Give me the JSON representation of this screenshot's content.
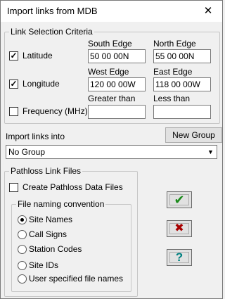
{
  "window": {
    "title": "Import links from MDB",
    "close_glyph": "✕"
  },
  "criteria": {
    "group_label": "Link Selection Criteria",
    "latitude": {
      "label": "Latitude",
      "checked": true
    },
    "longitude": {
      "label": "Longitude",
      "checked": true
    },
    "frequency": {
      "label": "Frequency (MHz)",
      "checked": false
    },
    "headers": {
      "south": "South Edge",
      "north": "North Edge",
      "west": "West Edge",
      "east": "East Edge",
      "greater": "Greater than",
      "less": "Less than"
    },
    "values": {
      "south": "50 00 00N",
      "north": "55 00 00N",
      "west": "120 00 00W",
      "east": "118 00 00W",
      "greater": "",
      "less": ""
    }
  },
  "import_into": {
    "label": "Import links into",
    "new_group_button": "New Group",
    "selected": "No Group"
  },
  "pathloss": {
    "group_label": "Pathloss Link Files",
    "create_files": {
      "label": "Create Pathloss Data Files",
      "checked": false
    },
    "naming": {
      "group_label": "File naming convention",
      "options": [
        "Site Names",
        "Call Signs",
        "Station Codes",
        "Site IDs",
        "User specified file names"
      ],
      "selected_index": 0
    }
  },
  "actions": {
    "ok_icon": "checkmark-icon",
    "cancel_icon": "x-icon",
    "help_icon": "question-icon",
    "ok_glyph": "✔",
    "cancel_glyph": "✖",
    "help_glyph": "?",
    "colors": {
      "ok": "#1a8a1a",
      "cancel": "#a80000",
      "help": "#008080"
    }
  }
}
